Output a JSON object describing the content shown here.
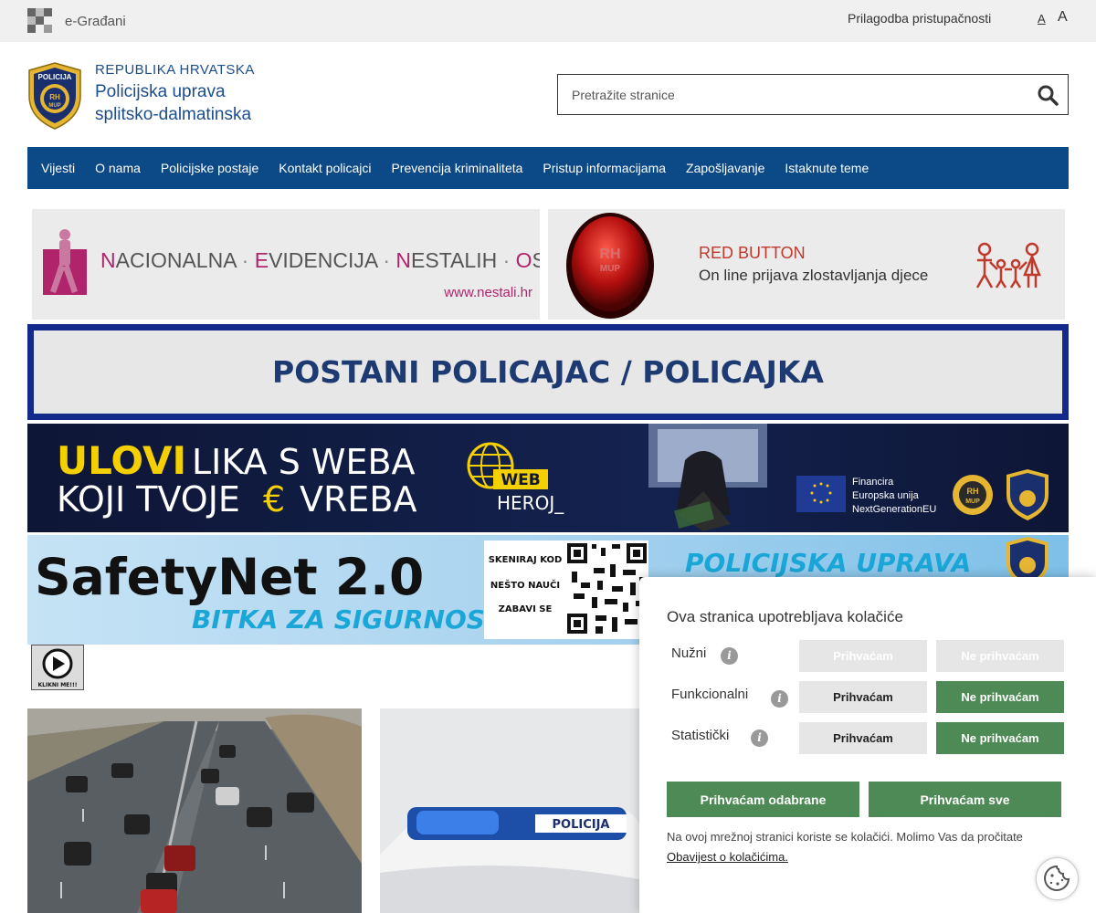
{
  "topbar": {
    "egradani_label": "e-Građani",
    "accessibility_label": "Prilagodba pristupačnosti",
    "font_small_label": "A",
    "font_large_label": "A"
  },
  "header": {
    "org_line1": "REPUBLIKA HRVATSKA",
    "org_line2": "Policijska uprava",
    "org_line3": "splitsko-dalmatinska",
    "badge_text_top": "POLICIJA",
    "badge_text_mid": "RH",
    "badge_text_bottom": "MUP"
  },
  "search": {
    "placeholder": "Pretražite stranice"
  },
  "nav": {
    "items": [
      {
        "label": "Vijesti"
      },
      {
        "label": "O nama"
      },
      {
        "label": "Policijske postaje"
      },
      {
        "label": "Kontakt policajci"
      },
      {
        "label": "Prevencija kriminaliteta"
      },
      {
        "label": "Pristup informacijama"
      },
      {
        "label": "Zapošljavanje"
      },
      {
        "label": "Istaknute teme"
      }
    ]
  },
  "banners": {
    "nestali": {
      "w1_first": "N",
      "w1_rest": "ACIONALNA",
      "w2_first": "E",
      "w2_rest": "VIDENCIJA",
      "w3_first": "N",
      "w3_rest": "ESTALIH",
      "w4_first": "O",
      "w4_rest": "SOBA",
      "sep": "·",
      "url": "www.nestali.hr"
    },
    "red_button": {
      "title": "RED BUTTON",
      "subtitle": "On line prijava  zlostavljanja djece",
      "badge_rh": "RH",
      "badge_mup": "MUP"
    },
    "postani": {
      "text": "POSTANI POLICAJAC / POLICAJKA"
    },
    "ulovi": {
      "word1": "ULOVI",
      "line1_rest": "LIKA S WEBA",
      "line2_start": "KOJI TVOJE",
      "euro": "€",
      "line2_end": "VREBA",
      "web": "WEB",
      "heroj": "HEROJ_",
      "eu_line1": "Financira",
      "eu_line2": "Europska unija",
      "eu_line3": "NextGenerationEU"
    },
    "safety": {
      "title": "SafetyNet 2.0",
      "subtitle": "BITKA  ZA SIGURNOST",
      "scan1": "SKENIRAJ KOD",
      "scan2": "NEŠTO NAUČI",
      "scan3": "ZABAVI SE",
      "right": "POLICIJSKA  UPRAVA"
    }
  },
  "play_button": {
    "label": "KLIKNI ME!!!"
  },
  "photos": {
    "police_car_text": "POLICIJA"
  },
  "cookie": {
    "title": "Ova stranica upotrebljava kolačiće",
    "info_glyph": "i",
    "rows": [
      {
        "label": "Nužni",
        "accept": "Prihvaćam",
        "reject": "Ne prihvaćam"
      },
      {
        "label": "Funkcionalni",
        "accept": "Prihvaćam",
        "reject": "Ne prihvaćam"
      },
      {
        "label": "Statistički",
        "accept": "Prihvaćam",
        "reject": "Ne prihvaćam"
      }
    ],
    "accept_selected": "Prihvaćam odabrane",
    "accept_all": "Prihvaćam sve",
    "note": "Na ovoj mrežnoj stranici koriste se kolačići. Molimo Vas da pročitate",
    "link": "Obavijest o kolačićima."
  },
  "colors": {
    "nav_bg": "#0b4987",
    "org_blue": "#1c4d8c",
    "cookie_green": "#4e8a55",
    "postani_border": "#122a8a",
    "nestali_pink": "#b0246b",
    "ulovi_yellow": "#f5d000"
  }
}
